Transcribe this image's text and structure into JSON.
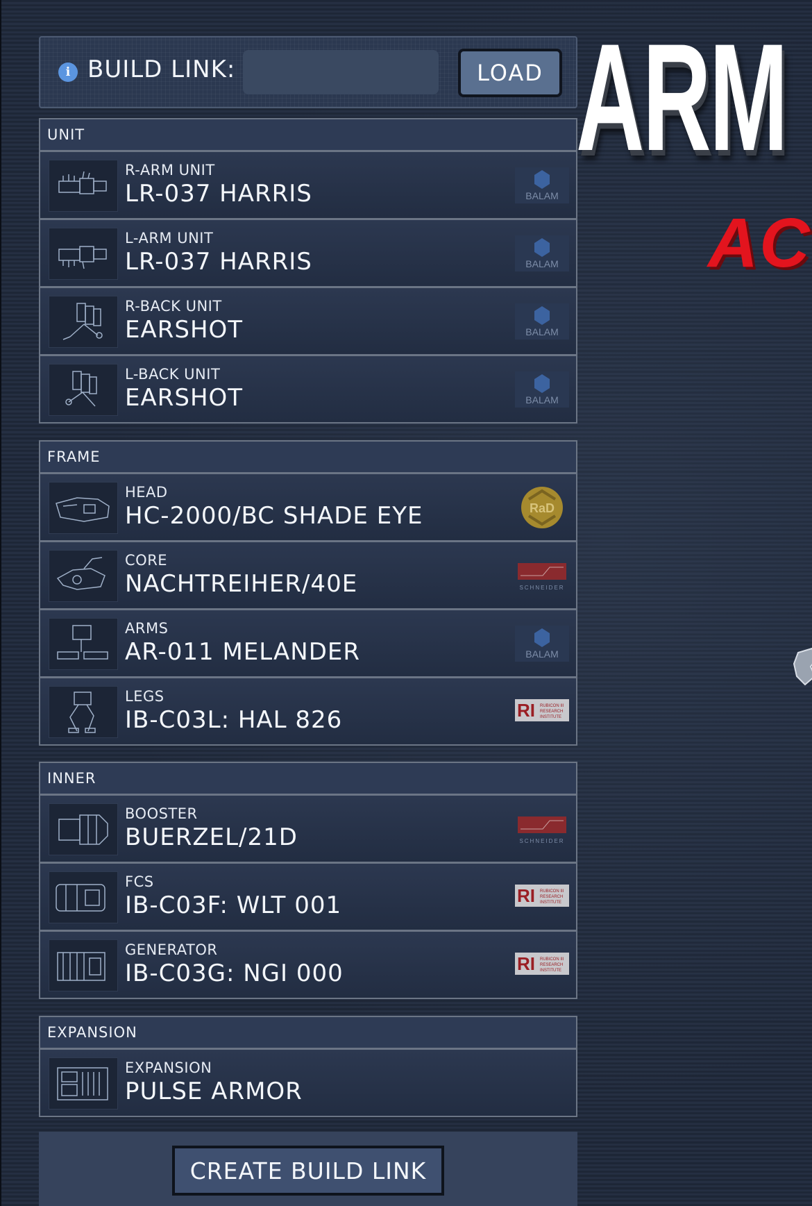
{
  "build_link": {
    "label": "BUILD LINK:",
    "input_value": "",
    "load_label": "LOAD"
  },
  "title": {
    "main": "ARM",
    "sub": "AC"
  },
  "sections": {
    "unit": {
      "header": "UNIT",
      "rows": [
        {
          "slot": "R-ARM UNIT",
          "name": "LR-037 HARRIS",
          "manufacturer": "BALAM"
        },
        {
          "slot": "L-ARM UNIT",
          "name": "LR-037 HARRIS",
          "manufacturer": "BALAM"
        },
        {
          "slot": "R-BACK UNIT",
          "name": "EARSHOT",
          "manufacturer": "BALAM"
        },
        {
          "slot": "L-BACK UNIT",
          "name": "EARSHOT",
          "manufacturer": "BALAM"
        }
      ]
    },
    "frame": {
      "header": "FRAME",
      "rows": [
        {
          "slot": "HEAD",
          "name": "HC-2000/BC SHADE EYE",
          "manufacturer": "RaD"
        },
        {
          "slot": "CORE",
          "name": "NACHTREIHER/40E",
          "manufacturer": "SCHNEIDER"
        },
        {
          "slot": "ARMS",
          "name": "AR-011 MELANDER",
          "manufacturer": "BALAM"
        },
        {
          "slot": "LEGS",
          "name": "IB-C03L: HAL 826",
          "manufacturer": "RUBICON RESEARCH INSTITUTE"
        }
      ]
    },
    "inner": {
      "header": "INNER",
      "rows": [
        {
          "slot": "BOOSTER",
          "name": "BUERZEL/21D",
          "manufacturer": "SCHNEIDER"
        },
        {
          "slot": "FCS",
          "name": "IB-C03F: WLT 001",
          "manufacturer": "RUBICON RESEARCH INSTITUTE"
        },
        {
          "slot": "GENERATOR",
          "name": "IB-C03G: NGI 000",
          "manufacturer": "RUBICON RESEARCH INSTITUTE"
        }
      ]
    },
    "expansion": {
      "header": "EXPANSION",
      "rows": [
        {
          "slot": "EXPANSION",
          "name": "PULSE ARMOR",
          "manufacturer": ""
        }
      ]
    }
  },
  "logos": {
    "balam": "BALAM",
    "rad": "RaD",
    "schneider": "SCHNEIDER",
    "ri_mark": "RI",
    "ri_text": "RUBICON III RESEARCH INSTITUTE"
  },
  "create_link_label": "CREATE BUILD LINK",
  "colors": {
    "background": "#222c3e",
    "panel": "#26324a",
    "border": "#6b7585",
    "accent_blue": "#5b95e0",
    "title_red": "#e3141e"
  },
  "icons": {
    "info": "info-icon",
    "balam": "balam-logo",
    "rad": "rad-logo",
    "schneider": "schneider-logo",
    "rubicon": "rubicon-logo"
  }
}
